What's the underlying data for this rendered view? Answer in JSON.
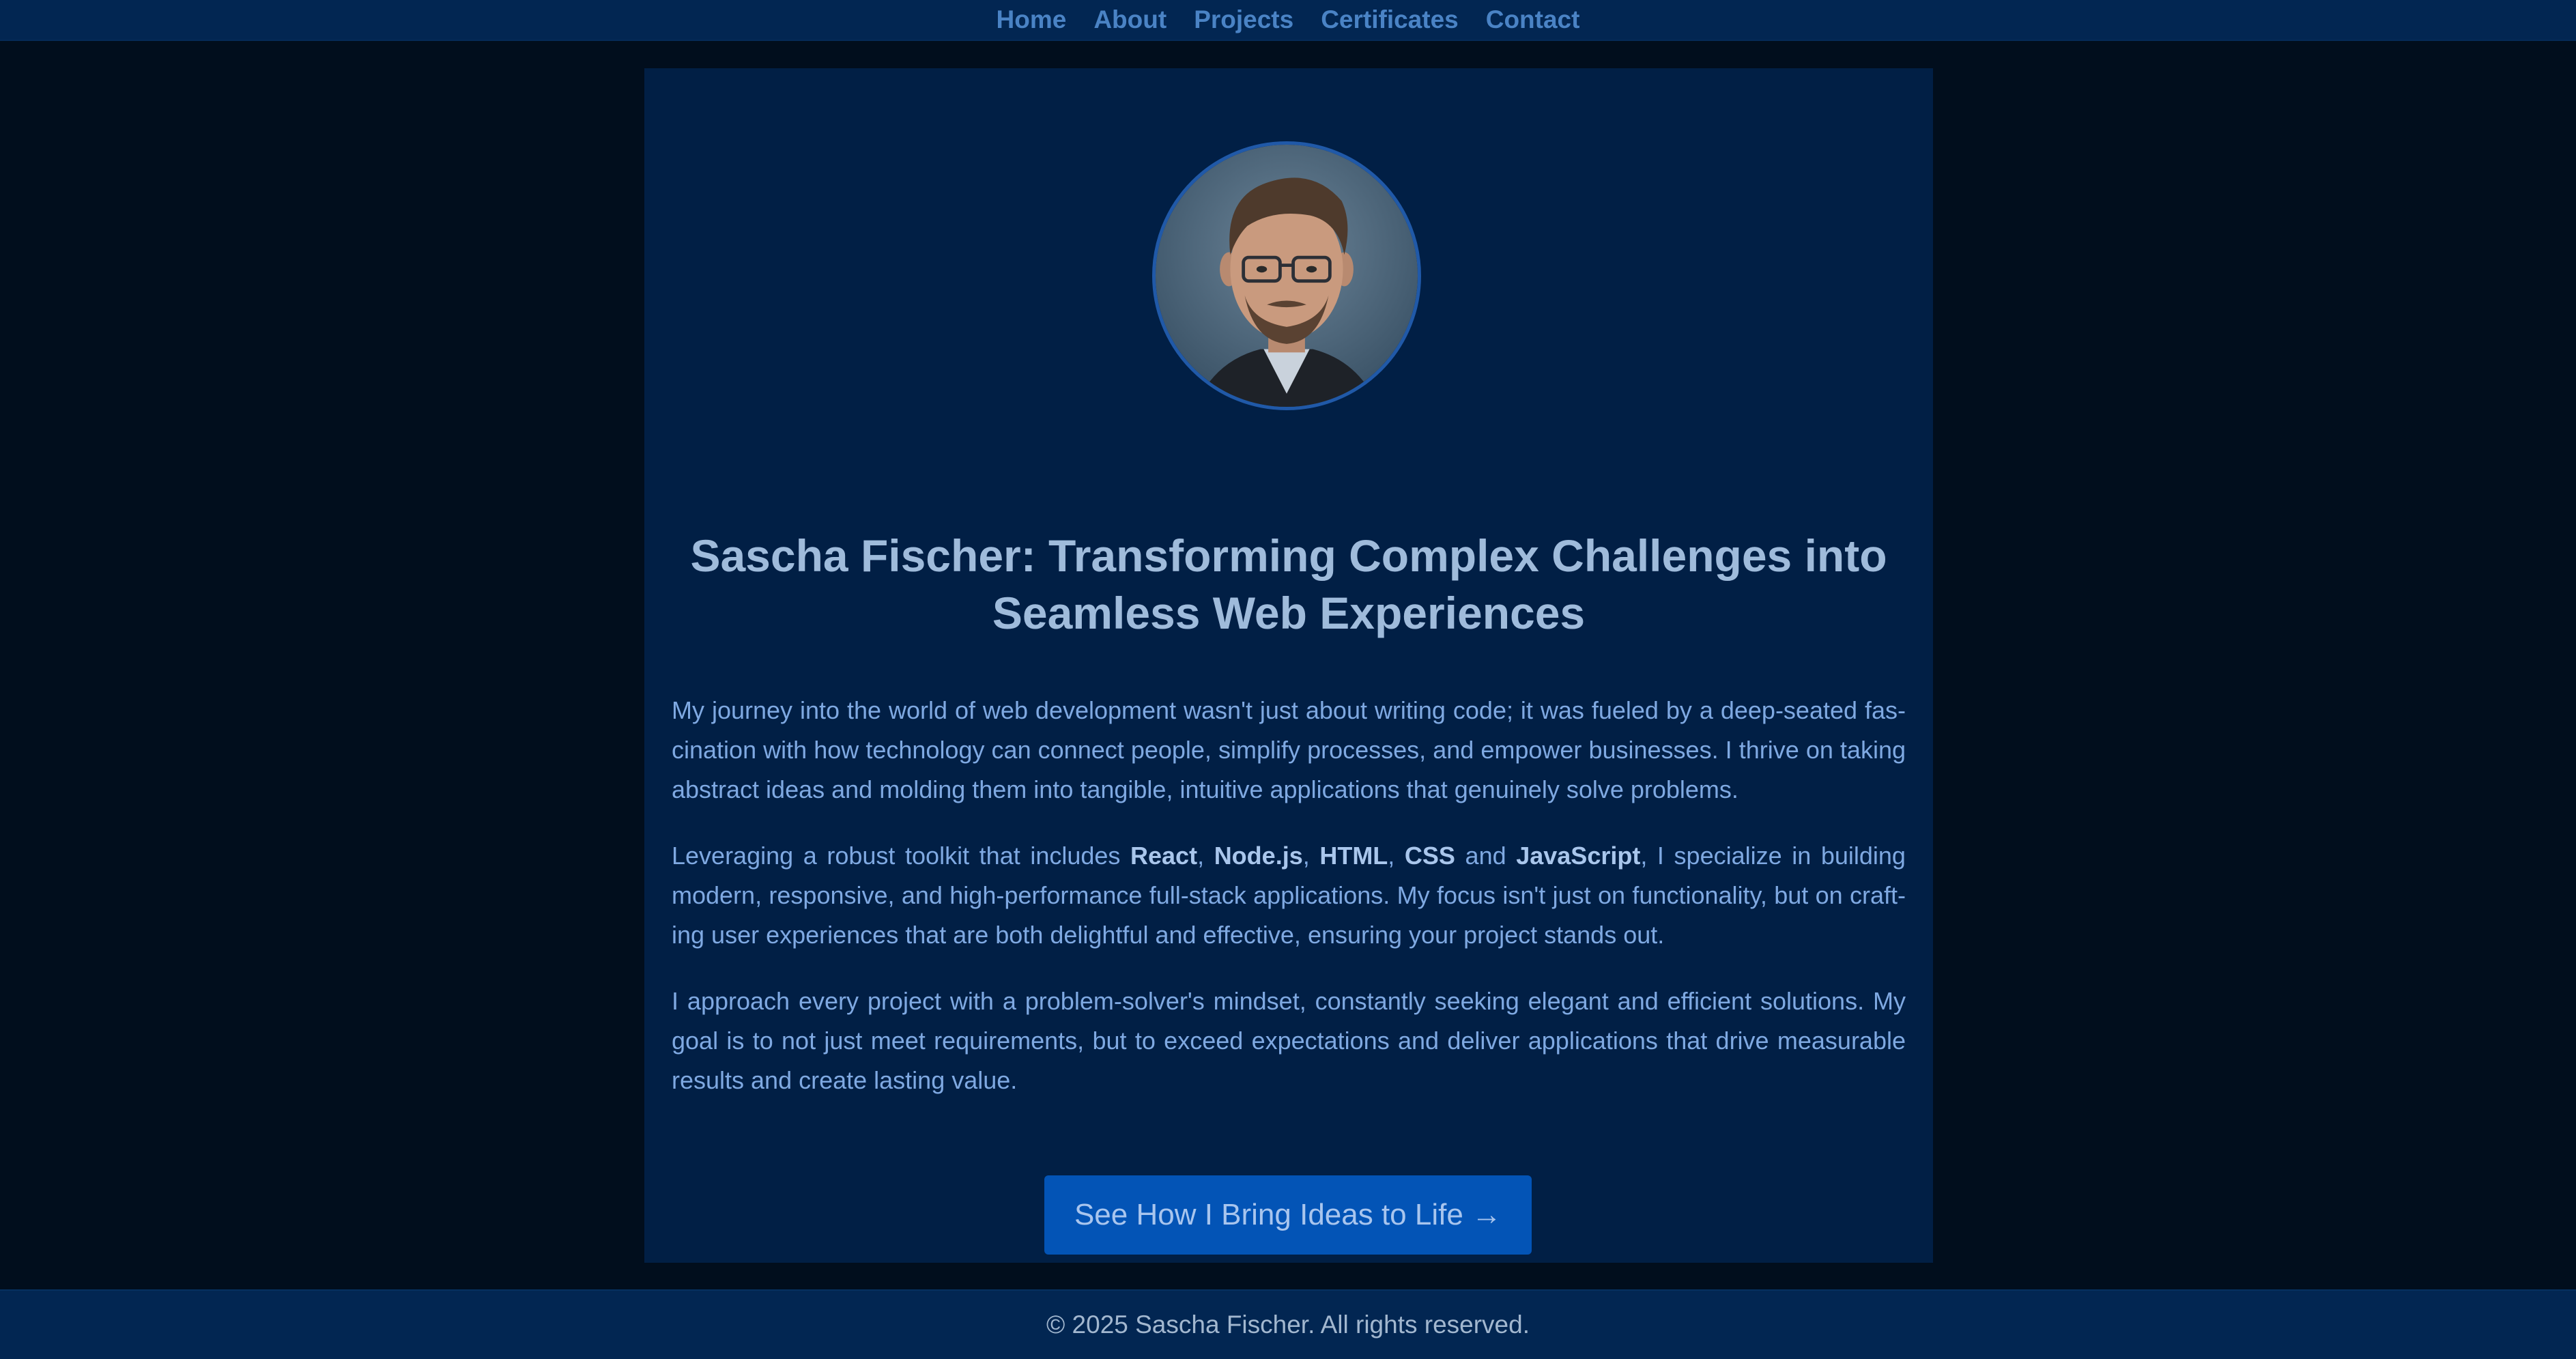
{
  "nav": {
    "items": [
      {
        "label": "Home"
      },
      {
        "label": "About"
      },
      {
        "label": "Projects"
      },
      {
        "label": "Certificates"
      },
      {
        "label": "Contact"
      }
    ]
  },
  "hero": {
    "title": "Sascha Fischer: Transforming Complex Challenges into Seamless Web Experiences",
    "paragraph1": "My journey into the world of web development wasn't just about writing code; it was fueled by a deep-seated fas­cination with how technology can connect people, simplify processes, and empower businesses. I thrive on taking abstract ideas and molding them into tangible, intuitive applications that genuinely solve problems.",
    "paragraph2": {
      "intro": "Leveraging a robust toolkit that includes ",
      "skills": [
        "React",
        "Node.js",
        "HTML",
        "CSS",
        "JavaScript"
      ],
      "sep1": ", ",
      "sep_and": " and ",
      "outro": ", I specialize in building modern, responsive, and high-performance full-stack applications. My focus isn't just on functionality, but on craft­ing user experiences that are both delightful and effective, ensuring your project stands out."
    },
    "paragraph3": "I approach every project with a problem-solver's mindset, constantly seeking elegant and efficient solutions. My goal is to not just meet requirements, but to exceed expectations and deliver applications that drive measurable results and create lasting value.",
    "cta_label": "See How I Bring Ideas to Life →"
  },
  "footer": {
    "text": "© 2025 Sascha Fischer. All rights reserved."
  },
  "colors": {
    "page_bg": "#010e1d",
    "nav_bg": "#022652",
    "card_bg": "#011f45",
    "accent": "#0354b6",
    "title": "#9fbbdb",
    "body_text": "#7fa9e2"
  }
}
